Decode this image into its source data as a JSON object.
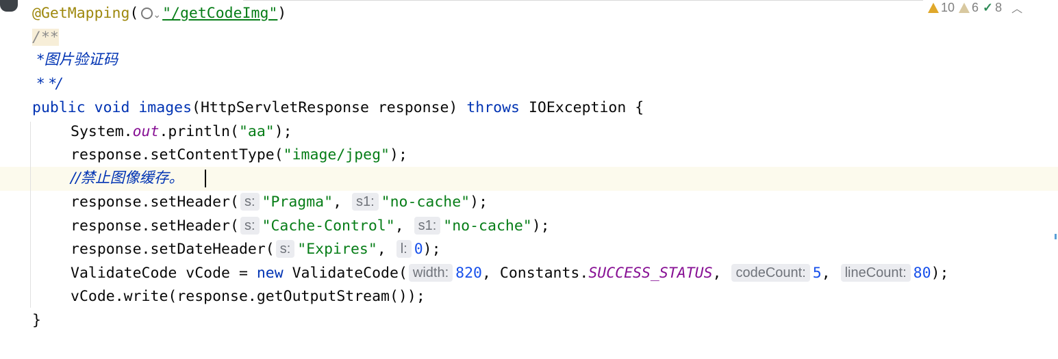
{
  "inspections": {
    "warnings": "10",
    "weak_warnings": "6",
    "typos": "8"
  },
  "code": {
    "l1": {
      "annotation": "@GetMapping",
      "paren_open": "(",
      "path": "\"/getCodeImg\"",
      "paren_close": ")"
    },
    "l2": {
      "text": "/**"
    },
    "l3": {
      "text": " *图片验证码"
    },
    "l4": {
      "text": " * */"
    },
    "l5": {
      "kw1": "public",
      "kw2": "void",
      "name": "images",
      "params": "(HttpServletResponse response)",
      "kw3": "throws",
      "exc": "IOException {"
    },
    "l6": {
      "a": "System.",
      "field": "out",
      "b": ".println(",
      "str": "\"aa\"",
      "c": ");"
    },
    "l7": {
      "a": "response.setContentType(",
      "str": "\"image/jpeg\"",
      "c": ");"
    },
    "l8": {
      "text": "//禁止图像缓存。"
    },
    "l9": {
      "a": "response.setHeader(",
      "hint1": "s:",
      "str1": "\"Pragma\"",
      "sep": ",",
      "hint2": "s1:",
      "str2": "\"no-cache\"",
      "c": ");"
    },
    "l10": {
      "a": "response.setHeader(",
      "hint1": "s:",
      "str1": "\"Cache-Control\"",
      "sep": ",",
      "hint2": "s1:",
      "str2": "\"no-cache\"",
      "c": ");"
    },
    "l11": {
      "a": "response.setDateHeader(",
      "hint1": "s:",
      "str1": "\"Expires\"",
      "sep": ",",
      "hint2": "l:",
      "num": "0",
      "c": ");"
    },
    "l12": {
      "a": "ValidateCode vCode = ",
      "kw": "new",
      "b": " ValidateCode(",
      "hint1": "width:",
      "num1": "820",
      "sep1": ", Constants.",
      "field": "SUCCESS_STATUS",
      "sep2": ",",
      "hint2": "codeCount:",
      "num2": "5",
      "sep3": ",",
      "hint3": "lineCount:",
      "num3": "80",
      "c": ");"
    },
    "l13": {
      "text": "vCode.write(response.getOutputStream());"
    },
    "l14": {
      "text": "}"
    }
  }
}
